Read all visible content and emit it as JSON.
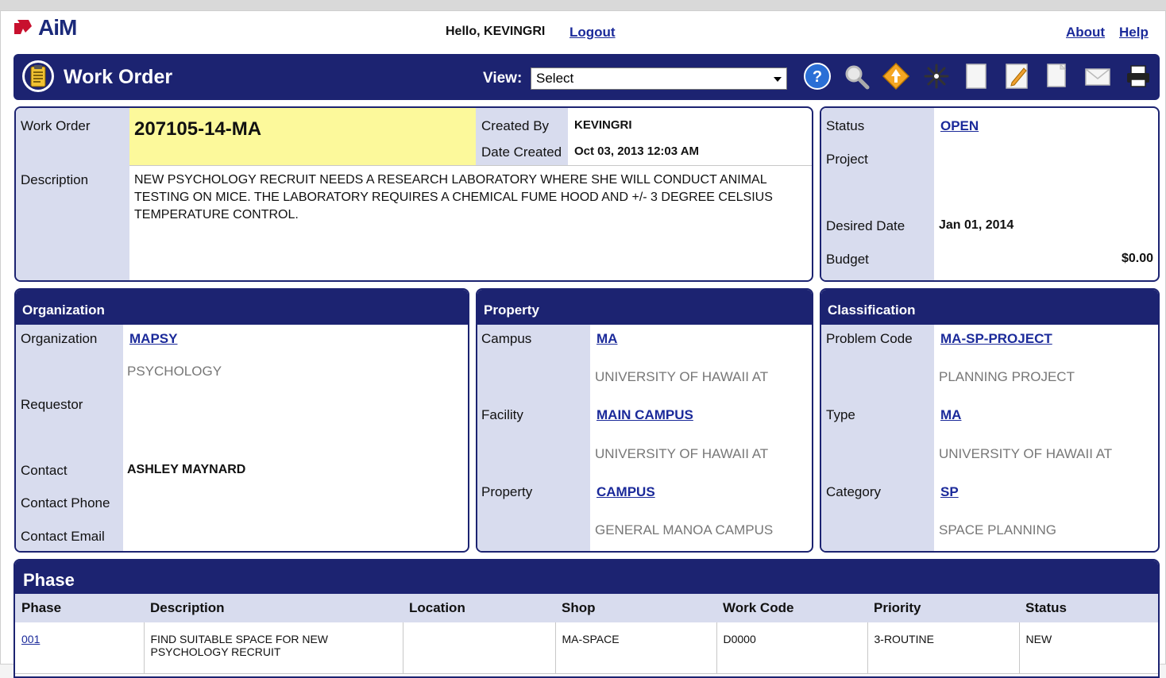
{
  "app": {
    "logo_text": "AiM"
  },
  "topbar": {
    "greeting": "Hello, KEVINGRI",
    "logout": "Logout",
    "about": "About",
    "help": "Help"
  },
  "titlebar": {
    "title": "Work Order",
    "view_label": "View:",
    "view_selected": "Select",
    "icons": [
      "help-icon",
      "search-icon",
      "navigate-icon",
      "new-icon",
      "blank-page-icon",
      "edit-icon",
      "copy-icon",
      "email-icon",
      "print-icon"
    ]
  },
  "header": {
    "work_order_label": "Work Order",
    "work_order_number": "207105-14-MA",
    "created_by_label": "Created By",
    "created_by": "KEVINGRI",
    "date_created_label": "Date Created",
    "date_created": "Oct 03, 2013 12:03 AM",
    "description_label": "Description",
    "description": "NEW PSYCHOLOGY RECRUIT NEEDS A RESEARCH LABORATORY WHERE SHE WILL CONDUCT ANIMAL TESTING ON MICE.  THE LABORATORY REQUIRES A CHEMICAL FUME HOOD AND +/- 3 DEGREE CELSIUS TEMPERATURE CONTROL."
  },
  "status_panel": {
    "status_label": "Status",
    "status": "OPEN",
    "project_label": "Project",
    "desired_date_label": "Desired Date",
    "desired_date": "Jan 01, 2014",
    "budget_label": "Budget",
    "budget": "$0.00"
  },
  "organization": {
    "title": "Organization",
    "org_label": "Organization",
    "org_code": "MAPSY",
    "org_name": "PSYCHOLOGY",
    "requestor_label": "Requestor",
    "contact_label": "Contact",
    "contact": "ASHLEY MAYNARD",
    "contact_phone_label": "Contact Phone",
    "contact_email_label": "Contact Email"
  },
  "property": {
    "title": "Property",
    "campus_label": "Campus",
    "campus_code": "MA",
    "campus_name": "UNIVERSITY OF HAWAII AT",
    "facility_label": "Facility",
    "facility_code": "MAIN CAMPUS",
    "facility_name": "UNIVERSITY OF HAWAII AT",
    "property_label": "Property",
    "property_code": "CAMPUS",
    "property_name": "GENERAL MANOA CAMPUS"
  },
  "classification": {
    "title": "Classification",
    "problem_code_label": "Problem Code",
    "problem_code": "MA-SP-PROJECT",
    "problem_name": "PLANNING PROJECT",
    "type_label": "Type",
    "type_code": "MA",
    "type_name": "UNIVERSITY OF HAWAII AT",
    "category_label": "Category",
    "category_code": "SP",
    "category_name": "SPACE PLANNING"
  },
  "phase": {
    "title": "Phase",
    "columns": [
      "Phase",
      "Description",
      "Location",
      "Shop",
      "Work Code",
      "Priority",
      "Status"
    ],
    "rows": [
      {
        "phase": "001",
        "description": "FIND SUITABLE SPACE FOR NEW PSYCHOLOGY RECRUIT",
        "location": "",
        "shop": "MA-SPACE",
        "work_code": "D0000",
        "priority": "3-ROUTINE",
        "status": "NEW"
      }
    ]
  },
  "colors": {
    "navy": "#1c2371",
    "label_bg": "#d8dcee",
    "highlight": "#fcf99b",
    "link": "#1b2a9a"
  }
}
